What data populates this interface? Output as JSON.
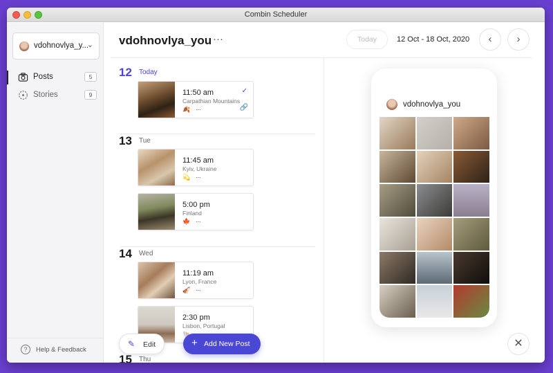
{
  "window": {
    "title": "Combin Scheduler"
  },
  "sidebar": {
    "account": "vdohnovlya_y...",
    "items": [
      {
        "label": "Posts",
        "count": "5",
        "icon": "camera-icon"
      },
      {
        "label": "Stories",
        "count": "9",
        "icon": "stories-icon"
      }
    ],
    "help": "Help & Feedback"
  },
  "header": {
    "account_title": "vdohnovlya_you",
    "more": "···",
    "today": "Today",
    "date_range": "12 Oct - 18 Oct, 2020",
    "prev": "‹",
    "next": "›"
  },
  "days": [
    {
      "num": "12",
      "label": "Today"
    },
    {
      "num": "13",
      "label": "Tue"
    },
    {
      "num": "14",
      "label": "Wed"
    },
    {
      "num": "15",
      "label": "Thu"
    }
  ],
  "posts": [
    {
      "time": "11:50 am",
      "location": "Carpathian Mountains",
      "emoji": "🍂",
      "dots": "...",
      "check": "✓",
      "link": "🔗"
    },
    {
      "time": "11:45 am",
      "location": "Kyiv, Ukraine",
      "emoji": "💫",
      "dots": "..."
    },
    {
      "time": "5:00 pm",
      "location": "Finland",
      "emoji": "🍁",
      "dots": "..."
    },
    {
      "time": "11:19 am",
      "location": "Lyon, France",
      "emoji": "🎻",
      "dots": "..."
    },
    {
      "time": "2:30 pm",
      "location": "Lisbon, Portugal",
      "emoji": "🐚",
      "dots": "..."
    }
  ],
  "actions": {
    "edit": "Edit",
    "add": "Add New Post",
    "add_icon": "+",
    "edit_icon": "✎",
    "close": "✕"
  },
  "preview": {
    "username": "vdohnovlya_you"
  },
  "colors": {
    "accent": "#4b45cf",
    "background": "#6a3fd0"
  }
}
